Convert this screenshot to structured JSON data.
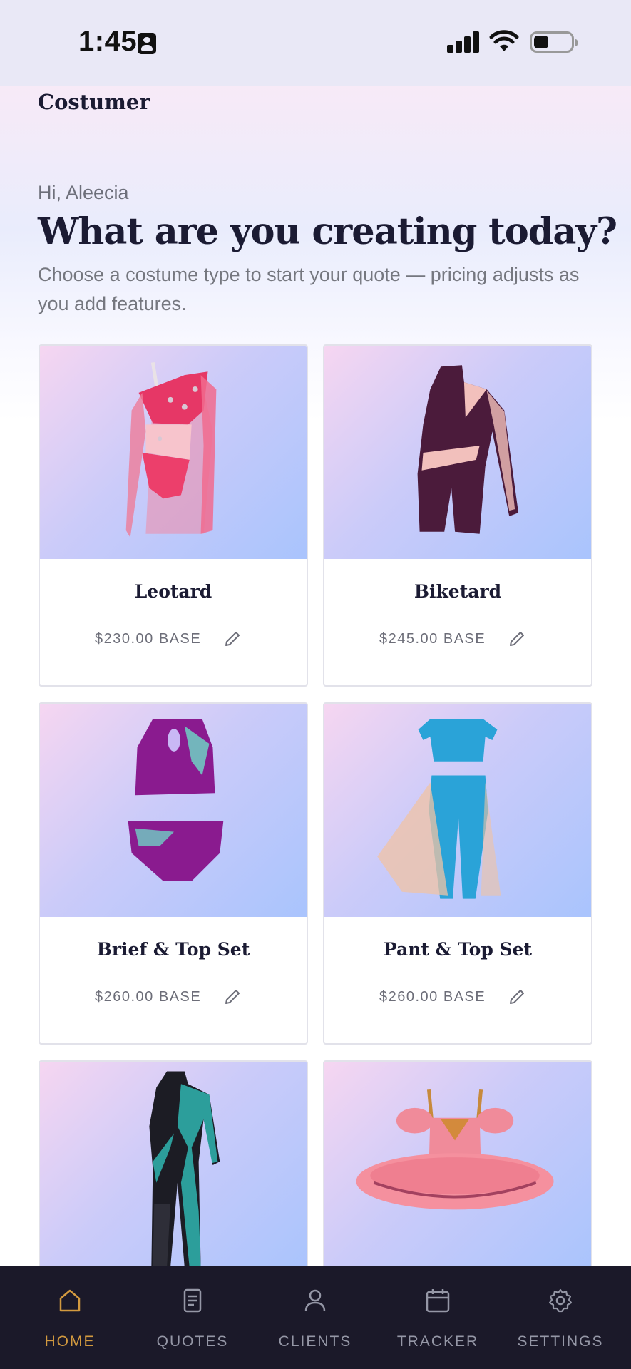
{
  "status_bar": {
    "time": "1:45"
  },
  "brand": "Costumer",
  "greeting": "Hi, Aleecia",
  "headline": "What are you creating today?",
  "subhead": "Choose a costume type to start your quote — pricing adjusts as you add features.",
  "cards": [
    {
      "title": "Leotard",
      "price": "$230.00 BASE",
      "icon": "leotard-illustration"
    },
    {
      "title": "Biketard",
      "price": "$245.00 BASE",
      "icon": "biketard-illustration"
    },
    {
      "title": "Brief & Top Set",
      "price": "$260.00 BASE",
      "icon": "brief-top-set-illustration"
    },
    {
      "title": "Pant & Top Set",
      "price": "$260.00 BASE",
      "icon": "pant-top-set-illustration"
    },
    {
      "title": "",
      "price": "",
      "icon": "unitard-illustration"
    },
    {
      "title": "",
      "price": "",
      "icon": "tutu-illustration"
    }
  ],
  "tabs": [
    {
      "label": "HOME",
      "icon": "home-icon",
      "active": true
    },
    {
      "label": "QUOTES",
      "icon": "quotes-icon",
      "active": false
    },
    {
      "label": "CLIENTS",
      "icon": "clients-icon",
      "active": false
    },
    {
      "label": "TRACKER",
      "icon": "calendar-icon",
      "active": false
    },
    {
      "label": "SETTINGS",
      "icon": "gear-icon",
      "active": false
    }
  ],
  "colors": {
    "accent": "#d39a3f",
    "tab_bar": "#1b1929",
    "heading": "#1b1b33"
  }
}
